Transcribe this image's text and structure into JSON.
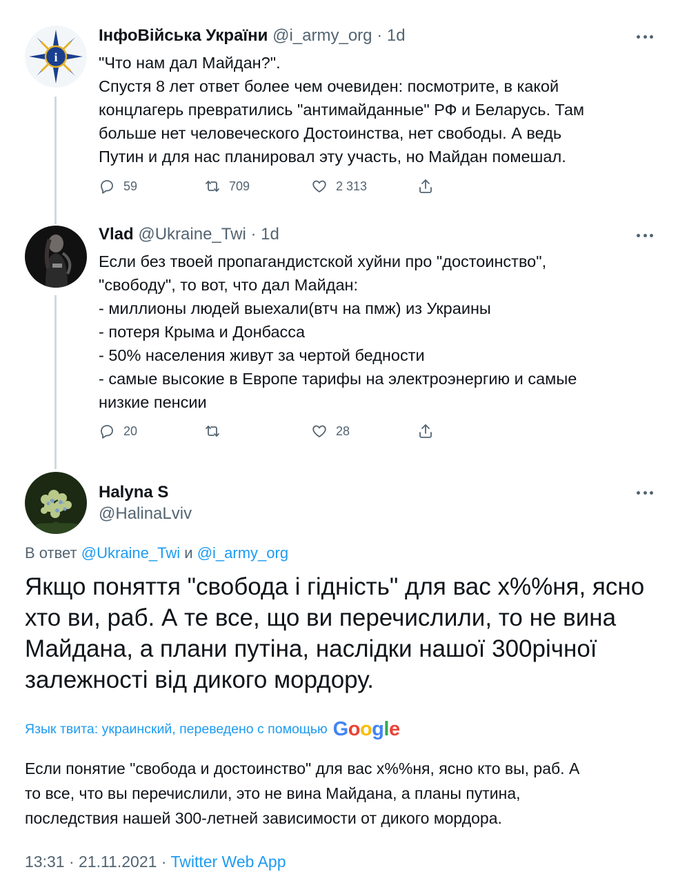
{
  "tweets": [
    {
      "name": "ІнфоВійська України",
      "handle": "@i_army_org",
      "time": "1d",
      "lines": [
        "\"Что нам дал Майдан?\".",
        "Спустя 8 лет ответ более чем очевиден: посмотрите, в какой",
        "концлагерь превратились \"антимайданные\" РФ и Беларусь. Там",
        "больше нет человеческого Достоинства, нет свободы. А ведь",
        "Путин и для нас планировал эту участь, но Майдан помешал."
      ],
      "replies": "59",
      "retweets": "709",
      "likes": "2 313"
    },
    {
      "name": "Vlad",
      "handle": "@Ukraine_Twi",
      "time": "1d",
      "lines": [
        "Если без твоей пропагандистской хуйни про \"достоинство\",",
        "\"свободу\", то вот, что дал Майдан:",
        "- миллионы людей выехали(втч на пмж) из Украины",
        "- потеря Крыма и Донбасса",
        "- 50% населения живут за чертой бедности",
        "- самые высокие в Европе тарифы на электроэнергию и самые",
        "низкие пенсии"
      ],
      "replies": "20",
      "retweets": "",
      "likes": "28"
    }
  ],
  "main_tweet": {
    "name": "Halyna S",
    "handle": "@HalinaLviv",
    "reply_prefix": "В ответ",
    "reply_user1": "@Ukraine_Twi",
    "reply_and": "и",
    "reply_user2": "@i_army_org",
    "lines": [
      "Якщо поняття \"свобода і гідність\" для вас х%%ня, ясно",
      "хто ви, раб. А те все, що ви перечислили, то не вина",
      "Майдана, а плани путіна, наслідки нашої 300річної",
      "залежності від дикого мордору."
    ],
    "translate_label": "Язык твита: украинский, переведено с помощью",
    "google": "Google",
    "translation_lines": [
      "Если понятие \"свобода и достоинство\" для вас х%%ня, ясно кто вы, раб. А",
      "то все, что вы перечислили, это не вина Майдана, а планы путина,",
      "последствия нашей 300-летней зависимости от дикого мордора."
    ],
    "timestamp": "13:31 · 21.11.2021 ·",
    "app": "Twitter Web App"
  },
  "colors": {
    "link": "#1d9bf0",
    "secondary": "#536471",
    "text": "#0f1419"
  }
}
